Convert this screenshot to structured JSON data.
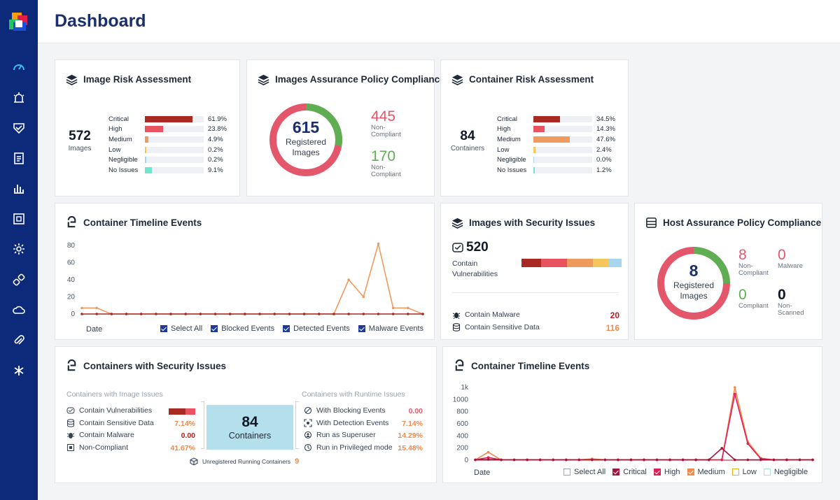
{
  "header": {
    "title": "Dashboard"
  },
  "sidebar": {
    "icons": [
      "dashboard-icon",
      "alert-icon",
      "shield-icon",
      "clipboard-icon",
      "bar-chart-icon",
      "scan-icon",
      "gear-icon",
      "link-icon",
      "cloud-icon",
      "paperclip-icon",
      "asterisk-icon"
    ]
  },
  "image_risk": {
    "title": "Image Risk Assessment",
    "total": "572",
    "total_label": "Images",
    "rows": [
      {
        "label": "Critical",
        "pct": "61.9%",
        "value": 61.9,
        "color": "#a92a23"
      },
      {
        "label": "High",
        "pct": "23.8%",
        "value": 23.8,
        "color": "#e9525f"
      },
      {
        "label": "Medium",
        "pct": "4.9%",
        "value": 4.9,
        "color": "#ef9a5e"
      },
      {
        "label": "Low",
        "pct": "0.2%",
        "value": 0.2,
        "color": "#f3c75a"
      },
      {
        "label": "Negligible",
        "pct": "0.2%",
        "value": 0.2,
        "color": "#a7d4ee"
      },
      {
        "label": "No Issues",
        "pct": "9.1%",
        "value": 9.1,
        "color": "#6ee6d2"
      }
    ]
  },
  "images_assurance": {
    "title": "Images Assurance Policy Compliance",
    "total": "615",
    "total_label_1": "Registered",
    "total_label_2": "Images",
    "non_compliant_value": "445",
    "non_compliant_label_1": "Non-",
    "non_compliant_label_2": "Compliant",
    "compliant_value": "170",
    "compliant_label_1": "Non-",
    "compliant_label_2": "Compliant",
    "colors": {
      "non_compliant": "#e4566a",
      "compliant": "#5fae54"
    }
  },
  "container_risk": {
    "title": "Container Risk Assessment",
    "total": "84",
    "total_label": "Containers",
    "rows": [
      {
        "label": "Critical",
        "pct": "34.5%",
        "value": 34.5,
        "color": "#a92a23"
      },
      {
        "label": "High",
        "pct": "14.3%",
        "value": 14.3,
        "color": "#e9525f"
      },
      {
        "label": "Medium",
        "pct": "47.6%",
        "value": 47.6,
        "color": "#ef9a5e"
      },
      {
        "label": "Low",
        "pct": "2.4%",
        "value": 2.4,
        "color": "#f3c75a"
      },
      {
        "label": "Negligible",
        "pct": "0.0%",
        "value": 0.0,
        "color": "#a7d4ee"
      },
      {
        "label": "No Issues",
        "pct": "1.2%",
        "value": 1.2,
        "color": "#6ee6d2"
      }
    ]
  },
  "timeline1": {
    "title": "Container Timeline Events",
    "xlabel": "Date",
    "legend": [
      "Select All",
      "Blocked Events",
      "Detected Events",
      "Malware Events"
    ],
    "legend_color": "#1e3a9a"
  },
  "images_security": {
    "title": "Images with Security Issues",
    "vuln_value": "520",
    "vuln_label_1": "Contain",
    "vuln_label_2": "Vulnerabilities",
    "malware_label": "Contain Malware",
    "malware_value": "20",
    "sensitive_label": "Contain Sensitive Data",
    "sensitive_value": "116",
    "bar_segments": [
      {
        "value": 15,
        "color": "#a92a23"
      },
      {
        "value": 20,
        "color": "#e9525f"
      },
      {
        "value": 20,
        "color": "#ef9a5e"
      },
      {
        "value": 12,
        "color": "#f3c75a"
      },
      {
        "value": 10,
        "color": "#a7d4ee"
      }
    ]
  },
  "host_assurance": {
    "title": "Host Assurance Policy Compliance",
    "total": "8",
    "total_label_1": "Registered",
    "total_label_2": "Images",
    "non_compliant_value": "8",
    "non_compliant_label_1": "Non-",
    "non_compliant_label_2": "Compliant",
    "malware_value": "0",
    "malware_label": "Malware",
    "compliant_value": "0",
    "compliant_label": "Compliant",
    "non_scanned_value": "0",
    "non_scanned_label_1": "Non-",
    "non_scanned_label_2": "Scanned"
  },
  "containers_security": {
    "title": "Containers with Security Issues",
    "image_issues_header": "Containers with Image Issues",
    "runtime_issues_header": "Containers with Runtime Issues",
    "image_issues": [
      {
        "label": "Contain Vulnerabilities",
        "value": ""
      },
      {
        "label": "Contain Sensitive Data",
        "value": "7.14%",
        "color": "#ef8a4a"
      },
      {
        "label": "Contain Malware",
        "value": "0.00",
        "color": "#b91c1c"
      },
      {
        "label": "Non-Compliant",
        "value": "41.67%",
        "color": "#ef8a4a"
      }
    ],
    "runtime_issues": [
      {
        "label": "With Blocking Events",
        "value": "0.00",
        "color": "#e4566a"
      },
      {
        "label": "With Detection Events",
        "value": "7.14%",
        "color": "#ef8a4a"
      },
      {
        "label": "Run as Superuser",
        "value": "14.29%",
        "color": "#ef8a4a"
      },
      {
        "label": "Run in Privileged mode",
        "value": "15.48%",
        "color": "#ef8a4a"
      }
    ],
    "center_value": "84",
    "center_label": "Containers",
    "unregistered_label": "Unregistered Running Containers",
    "unregistered_value": "9"
  },
  "timeline2": {
    "title": "Container Timeline Events",
    "xlabel": "Date",
    "legend": [
      {
        "label": "Select All",
        "color": "#9ca3af",
        "filled": false
      },
      {
        "label": "Critical",
        "color": "#a0163c",
        "filled": true
      },
      {
        "label": "High",
        "color": "#e11d5a",
        "filled": true
      },
      {
        "label": "Medium",
        "color": "#ef8a4a",
        "filled": true
      },
      {
        "label": "Low",
        "color": "#eab308",
        "filled": false
      },
      {
        "label": "Negligible",
        "color": "#a7e3d6",
        "filled": false
      }
    ]
  },
  "chart_data": [
    {
      "type": "line",
      "title": "Container Timeline Events",
      "xlabel": "Date",
      "ylabel": "",
      "ylim": [
        0,
        80
      ],
      "yticks": [
        "80",
        "60",
        "40",
        "20",
        "0"
      ],
      "series": [
        {
          "name": "Detected Events",
          "color": "#ef9a5e",
          "values": [
            7,
            7,
            0,
            0,
            0,
            0,
            0,
            0,
            0,
            0,
            0,
            0,
            0,
            0,
            0,
            0,
            0,
            0,
            40,
            20,
            82,
            7,
            7,
            0
          ]
        },
        {
          "name": "Blocked Events",
          "color": "#a92a23",
          "values": [
            0,
            0,
            0,
            0,
            0,
            0,
            0,
            0,
            0,
            0,
            0,
            0,
            0,
            0,
            0,
            0,
            0,
            0,
            0,
            0,
            0,
            0,
            0,
            0
          ]
        }
      ]
    },
    {
      "type": "line",
      "title": "Container Timeline Events",
      "xlabel": "Date",
      "ylabel": "",
      "ylim": [
        0,
        1100
      ],
      "yticks": [
        "1k",
        "1000",
        "800",
        "600",
        "400",
        "200",
        "0"
      ],
      "series": [
        {
          "name": "Medium",
          "color": "#ef8a4a",
          "values": [
            5,
            120,
            5,
            5,
            5,
            5,
            5,
            5,
            5,
            20,
            5,
            5,
            5,
            5,
            5,
            5,
            5,
            5,
            5,
            5,
            1100,
            280,
            30,
            5,
            5,
            5,
            5
          ]
        },
        {
          "name": "High",
          "color": "#e11d5a",
          "values": [
            5,
            40,
            5,
            5,
            5,
            5,
            5,
            5,
            5,
            5,
            5,
            5,
            5,
            5,
            5,
            5,
            5,
            5,
            5,
            5,
            1000,
            250,
            20,
            5,
            5,
            5,
            5
          ]
        },
        {
          "name": "Critical",
          "color": "#a0163c",
          "values": [
            5,
            10,
            5,
            5,
            5,
            5,
            5,
            5,
            5,
            5,
            5,
            5,
            5,
            5,
            5,
            5,
            5,
            5,
            5,
            180,
            5,
            5,
            5,
            5,
            5,
            5,
            5
          ]
        }
      ]
    }
  ]
}
